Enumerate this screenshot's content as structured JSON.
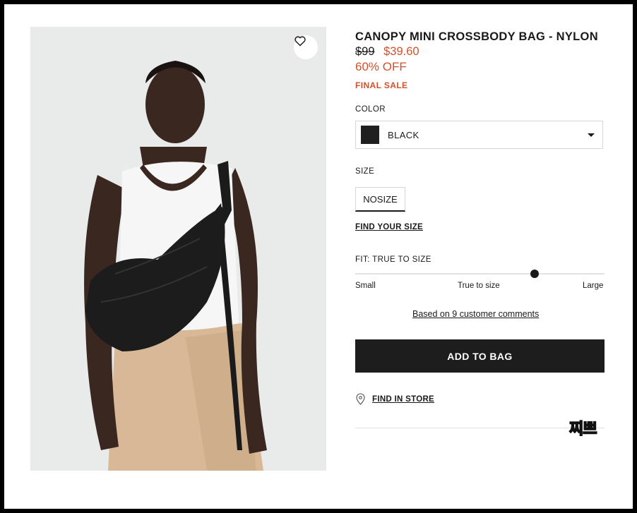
{
  "product": {
    "title": "CANOPY MINI CROSSBODY BAG - NYLON",
    "original_price": "$99",
    "sale_price": "$39.60",
    "discount": "60% OFF",
    "final_sale": "FINAL SALE"
  },
  "color": {
    "label": "COLOR",
    "selected": "BLACK",
    "swatch": "#1f1f1f"
  },
  "size": {
    "label": "SIZE",
    "option": "NOSIZE",
    "find_size": "FIND YOUR SIZE"
  },
  "fit": {
    "label": "FIT: TRUE TO SIZE",
    "small": "Small",
    "true": "True to size",
    "large": "Large",
    "comments": "Based on 9 customer comments"
  },
  "actions": {
    "add_to_bag": "ADD TO BAG",
    "find_in_store": "FIND IN STORE"
  },
  "sticker": "찌쁘",
  "colors": {
    "accent": "#d4502a",
    "button": "#1d1d1d",
    "sticker": "#ccff66"
  },
  "icons": [
    "heart-icon",
    "location-pin-icon",
    "caret-down-icon"
  ]
}
